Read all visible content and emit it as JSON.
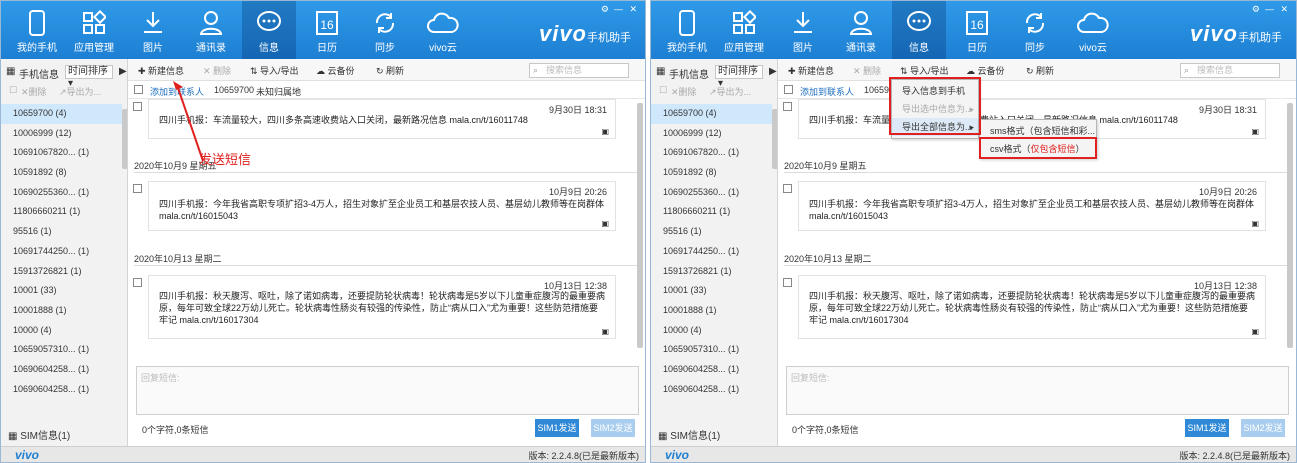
{
  "nav": [
    "我的手机",
    "应用管理",
    "图片",
    "通讯录",
    "信息",
    "日历",
    "同步",
    "vivo云"
  ],
  "calendar_day": "16",
  "logo": "vivo",
  "logo_sub": "手机助手",
  "side": {
    "label": "手机信息",
    "sort": "时间排序",
    "delete": "删除",
    "export_for": "导出为...",
    "sim": "SIM信息(1)"
  },
  "contacts": [
    "10659700 (4)",
    "10006999 (12)",
    "10691067820... (1)",
    "10591892 (8)",
    "10690255360... (1)",
    "11806660211 (1)",
    "95516 (1)",
    "10691744250... (1)",
    "15913726821 (1)",
    "10001 (33)",
    "10001888 (1)",
    "10000 (4)",
    "10659057310... (1)",
    "10690604258... (1)",
    "10690604258... (1)"
  ],
  "toolbar": {
    "new": "新建信息",
    "delete": "删除",
    "import_export": "导入/导出",
    "backup": "云备份",
    "refresh": "刷新",
    "search": "搜索信息"
  },
  "chead": {
    "add": "添加到联系人",
    "num": "10659700",
    "loc": "未知归属地"
  },
  "messages": [
    {
      "date": "",
      "time": "9月30日 18:31",
      "body": "四川手机报：车流量较大，四川多条高速收费站入口关闭，最新路况信息 mala.cn/t/16011748"
    },
    {
      "date": "2020年10月9 星期五",
      "time": "10月9日 20:26",
      "body": "四川手机报：今年我省高职专项扩招3-4万人，招生对象扩至企业员工和基层农技人员、基层幼儿教师等在岗群体 mala.cn/t/16015043"
    },
    {
      "date": "2020年10月13 星期二",
      "time": "10月13日 12:38",
      "body": "四川手机报：秋天腹泻、呕吐，除了诺如病毒，还要提防轮状病毒！轮状病毒是5岁以下儿童重症腹泻的最重要病原，每年可致全球22万幼儿死亡。轮状病毒性肠炎有较强的传染性，防止“病从口入”尤为重要！这些防范措施要牢记 mala.cn/t/16017304"
    }
  ],
  "reply_placeholder": "回复短信:",
  "counter": "0个字符,0条短信",
  "sim1": "SIM1发送",
  "sim2": "SIM2发送",
  "status": {
    "brand": "vivo",
    "version": "版本: 2.2.4.8(已是最新版本)"
  },
  "annotation": "发送短信",
  "menu": {
    "import": "导入信息到手机",
    "export_sel": "导出选中信息为...",
    "export_all": "导出全部信息为...",
    "sms": "sms格式（包含短信和彩...",
    "csv": "csv格式（",
    "csv_red": "仅包含短信",
    "csv_end": "）"
  },
  "colors": {
    "header": "#1d7fd3",
    "accent": "#e0201e",
    "send_btn": "#2f89d6",
    "send_btn_dis": "#a9cdee"
  }
}
